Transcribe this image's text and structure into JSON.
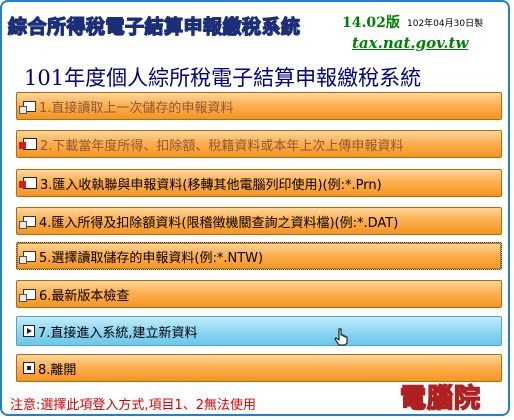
{
  "header": {
    "banner": "綜合所得稅電子結算申報繳稅系統",
    "version": "14.02版",
    "date": "102年04月30日製",
    "website": "tax.nat.gov.tw"
  },
  "title": "101年度個人綜所稅電子結算申報繳稅系統",
  "menu": [
    {
      "label": "1.直接讀取上一次儲存的申報資料",
      "icon": "folder-doc-icon",
      "state": "disabled"
    },
    {
      "label": "2.下載當年度所得、扣除額、稅籍資料或本年上次上傳申報資料",
      "icon": "download-doc-icon",
      "state": "disabled"
    },
    {
      "label": "3.匯入收執聯與申報資料(移轉其他電腦列印使用)(例:*.Prn)",
      "icon": "import-red-icon",
      "state": "normal"
    },
    {
      "label": "4.匯入所得及扣除額資料(限稽徵機關查詢之資料檔)(例:*.DAT)",
      "icon": "folder-doc-icon",
      "state": "normal"
    },
    {
      "label": "5.選擇讀取儲存的申報資料(例:*.NTW)",
      "icon": "folder-doc-icon",
      "state": "selected"
    },
    {
      "label": "6.最新版本檢查",
      "icon": "folder-doc-icon",
      "state": "normal"
    },
    {
      "label": "7.直接進入系統,建立新資料",
      "icon": "play-icon",
      "state": "hover"
    },
    {
      "label": "8.離開",
      "icon": "exit-box-icon",
      "state": "normal"
    }
  ],
  "note": "注意:選擇此項登入方式,項目1、2無法使用",
  "watermark": "電腦院",
  "colors": {
    "accent": "#1f7fd0",
    "menu_orange": "#f59520",
    "menu_blue": "#8fd7f2",
    "note_red": "#e00000",
    "site_green": "#008000"
  }
}
